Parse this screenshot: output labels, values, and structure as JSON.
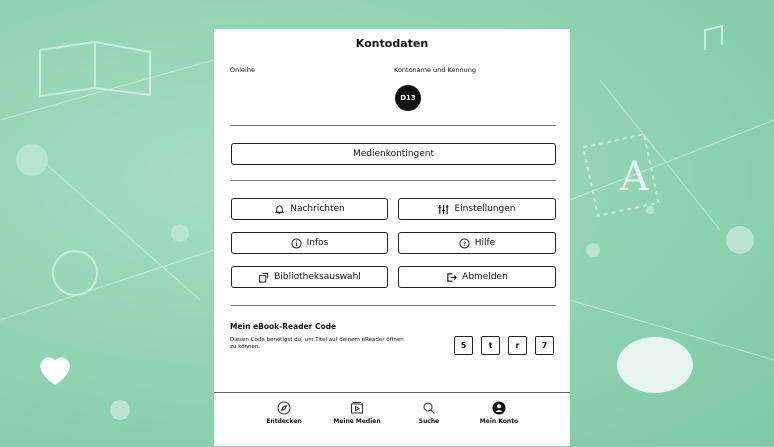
{
  "header": {
    "title": "Kontodaten"
  },
  "account": {
    "left_label": "Onleihe",
    "right_label": "Kontoname und Kennung",
    "avatar_text": "D13"
  },
  "buttons": {
    "medienkontingent": "Medienkontingent",
    "nachrichten": "Nachrichten",
    "einstellungen": "Einstellungen",
    "infos": "Infos",
    "hilfe": "Hilfe",
    "bibliotheksauswahl": "Bibliotheksauswahl",
    "abmelden": "Abmelden"
  },
  "reader_code": {
    "heading": "Mein eBook-Reader Code",
    "description": "Diesen Code benötigst du, um Titel auf deinem eReader öffnen zu können.",
    "chars": [
      "5",
      "t",
      "r",
      "7"
    ]
  },
  "tabbar": {
    "entdecken": "Entdecken",
    "meine_medien": "Meine Medien",
    "suche": "Suche",
    "mein_konto": "Mein Konto"
  },
  "colors": {
    "background": "#8fd3b2",
    "panel": "#ffffff",
    "text": "#111111"
  }
}
